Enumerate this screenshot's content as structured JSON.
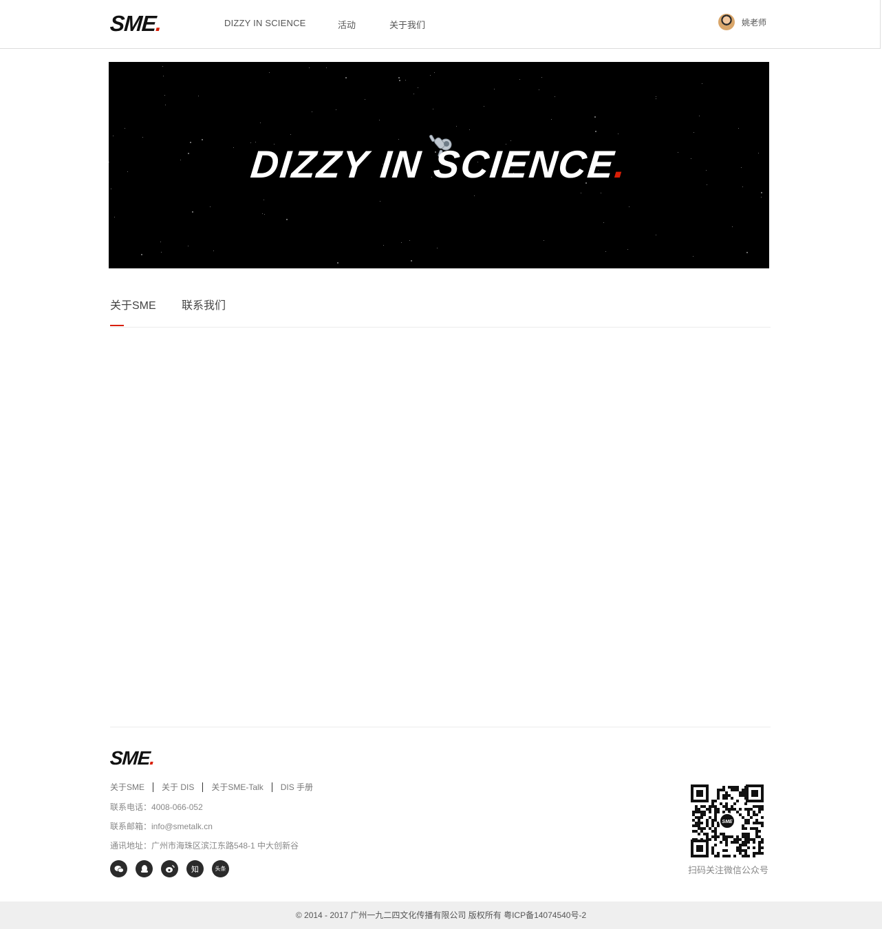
{
  "header": {
    "logo_text": "SME",
    "logo_dot": ".",
    "nav": {
      "dis": "DIZZY IN SCIENCE",
      "activities": "活动",
      "about": "关于我们"
    },
    "user_name": "姚老师"
  },
  "banner": {
    "title": "DIZZY IN SCIENCE",
    "dot": "."
  },
  "tabs": {
    "about": "关于SME",
    "contact": "联系我们"
  },
  "footer": {
    "logo_text": "SME",
    "logo_dot": ".",
    "links": [
      "关于SME",
      "关于 DIS",
      "关于SME-Talk",
      "DIS 手册"
    ],
    "phone_label": "联系电话：",
    "phone": "4008-066-052",
    "email_label": "联系邮箱：",
    "email": "info@smetalk.cn",
    "address_label": "通讯地址：",
    "address": "广州市海珠区滨江东路548-1 中大创新谷",
    "social_icons": [
      "wechat-icon",
      "qq-icon",
      "weibo-icon",
      "zhihu-icon",
      "toutiao-icon"
    ],
    "zhihu_label": "知",
    "toutiao_label": "头条",
    "qr_caption": "扫码关注微信公众号",
    "qr_center_text": "SME"
  },
  "copyright": "© 2014 - 2017 广州一九二四文化传播有限公司   版权所有   粤ICP备14074540号-2",
  "colors": {
    "accent": "#d81e06",
    "banner_bg": "#000000",
    "footer_bg": "#efefef"
  }
}
